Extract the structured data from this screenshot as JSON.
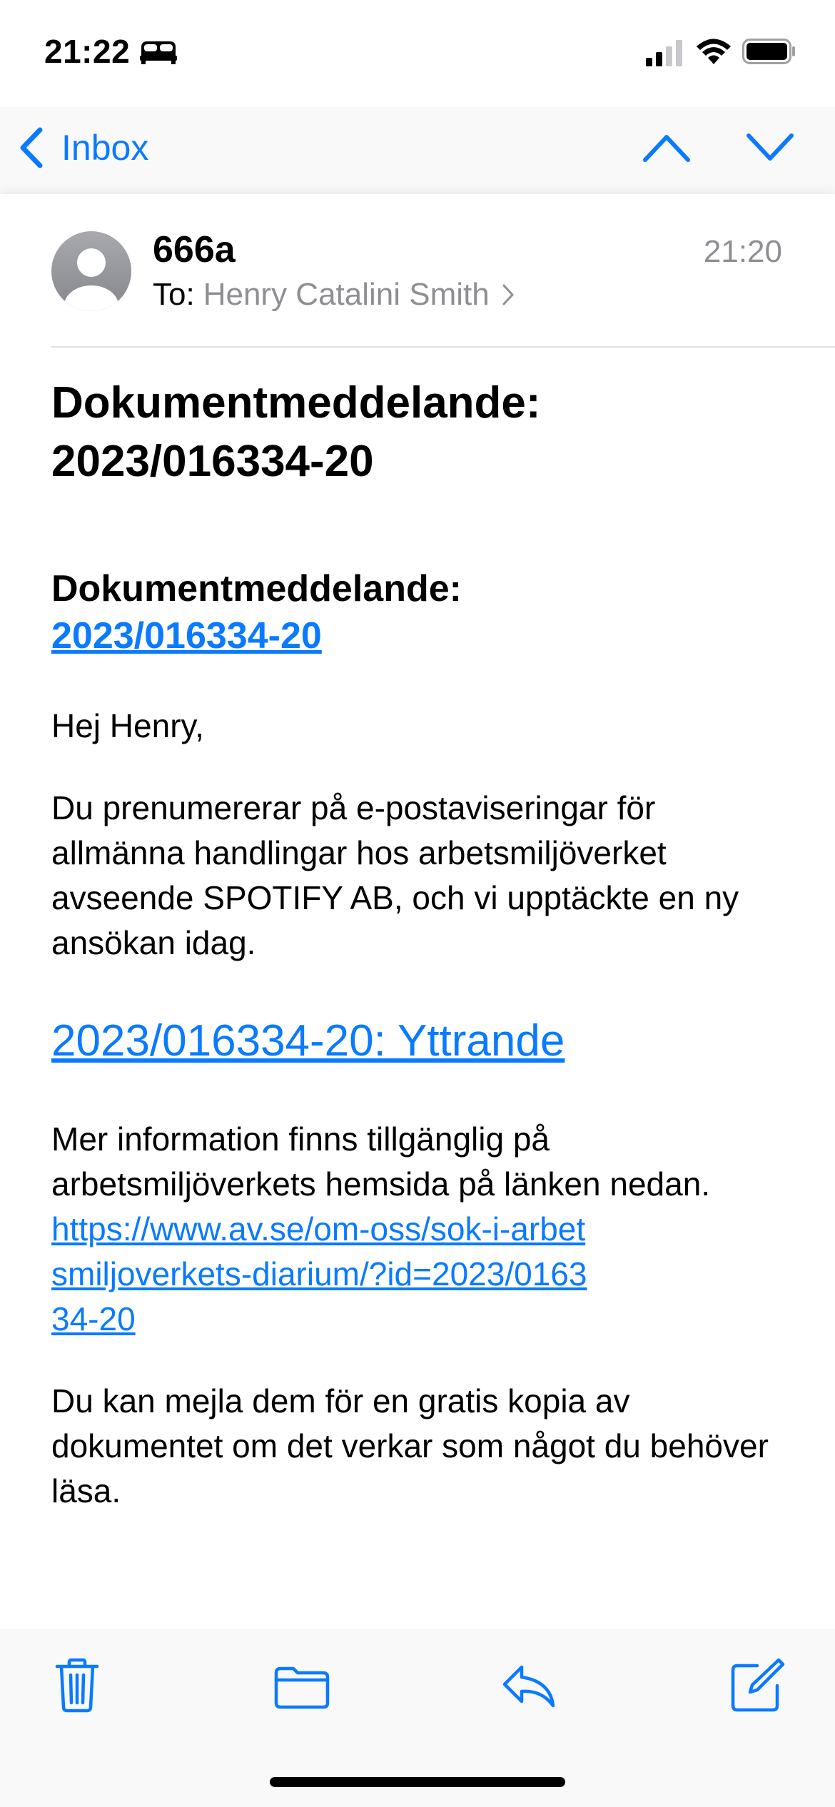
{
  "status_bar": {
    "time": "21:22",
    "icons": [
      "sleep-focus-icon",
      "cellular-signal-icon",
      "wifi-icon",
      "battery-icon"
    ]
  },
  "nav": {
    "back_label": "Inbox",
    "icons": [
      "chevron-left-icon",
      "chevron-up-icon",
      "chevron-down-icon"
    ]
  },
  "message": {
    "sender": "666a",
    "time": "21:20",
    "to_label": "To:",
    "to_name": "Henry Catalini Smith",
    "subject_line1": "Dokumentmeddelande:",
    "subject_line2": "2023/016334-20",
    "body": {
      "heading_label": "Dokumentmeddelande:",
      "heading_link": "2023/016334-20",
      "greeting": "Hej Henry,",
      "paragraph1": "Du prenumererar på e-postaviseringar för allmänna handlingar hos arbetsmiljöverket avseende SPOTIFY AB, och vi upptäckte en ny ansökan idag.",
      "document_link": "2023/016334-20: Yttrande",
      "paragraph2": "Mer information finns tillgänglig på arbetsmiljöverkets hemsida på länken nedan.",
      "url": "https://www.av.se/om-oss/sok-i-arbetsmiljoverkets-diarium/?id=2023/016334-20",
      "paragraph3": "Du kan mejla dem för en gratis kopia av dokumentet om det verkar som något du behöver läsa."
    }
  },
  "toolbar": {
    "icons": [
      "trash-icon",
      "folder-icon",
      "reply-icon",
      "compose-icon"
    ]
  },
  "colors": {
    "accent": "#0a7aff",
    "secondary_text": "#8e8e93",
    "bar_background": "#f9f9f9"
  }
}
